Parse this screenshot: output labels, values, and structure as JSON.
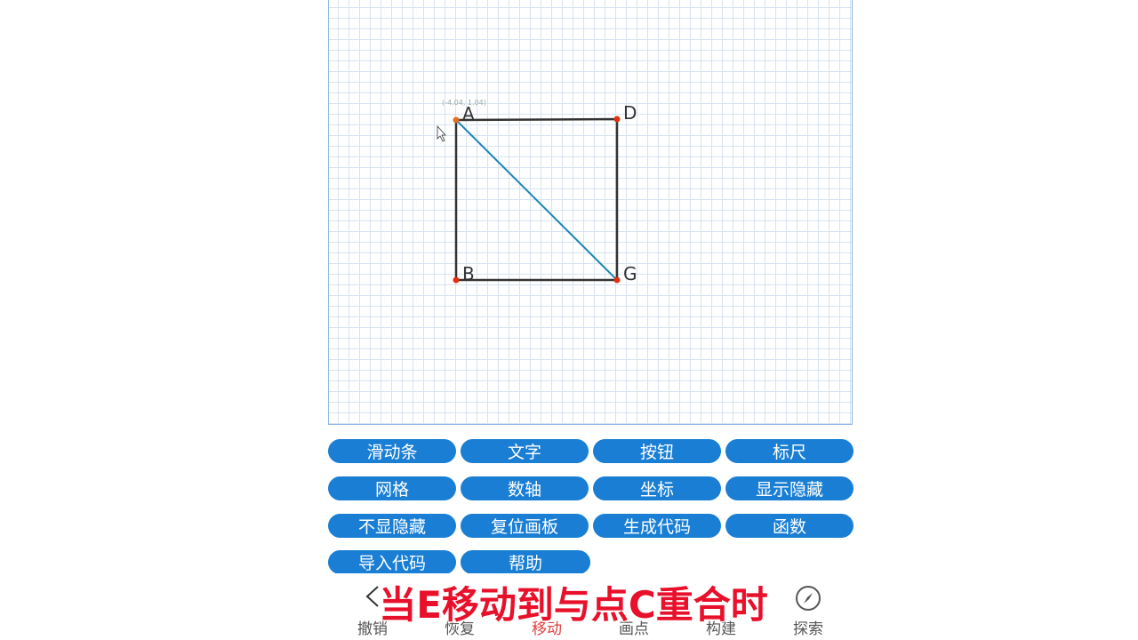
{
  "canvas": {
    "coord_readout": "(-4.04, 1.04)",
    "points": [
      {
        "name": "A",
        "label": "A"
      },
      {
        "name": "D",
        "label": "D"
      },
      {
        "name": "B",
        "label": "B"
      },
      {
        "name": "G",
        "label": "G"
      }
    ],
    "colors": {
      "square": "#333333",
      "diagonal": "#1f86b5",
      "point": "#e03010",
      "grid": "#d7e3f2"
    }
  },
  "toolbar": {
    "rows": [
      [
        "滑动条",
        "文字",
        "按钮",
        "标尺"
      ],
      [
        "网格",
        "数轴",
        "坐标",
        "显示隐藏"
      ],
      [
        "不显隐藏",
        "复位画板",
        "生成代码",
        "函数"
      ],
      [
        "导入代码",
        "帮助"
      ]
    ]
  },
  "bottom_nav": {
    "tabs": [
      {
        "label": "撤销",
        "icon": "back-arrow-icon",
        "active": false
      },
      {
        "label": "恢复",
        "icon": "",
        "active": false
      },
      {
        "label": "移动",
        "icon": "",
        "active": true
      },
      {
        "label": "画点",
        "icon": "",
        "active": false
      },
      {
        "label": "构建",
        "icon": "",
        "active": false
      },
      {
        "label": "探索",
        "icon": "compass-icon",
        "active": false
      }
    ]
  },
  "subtitle": "当E移动到与点C重合时"
}
